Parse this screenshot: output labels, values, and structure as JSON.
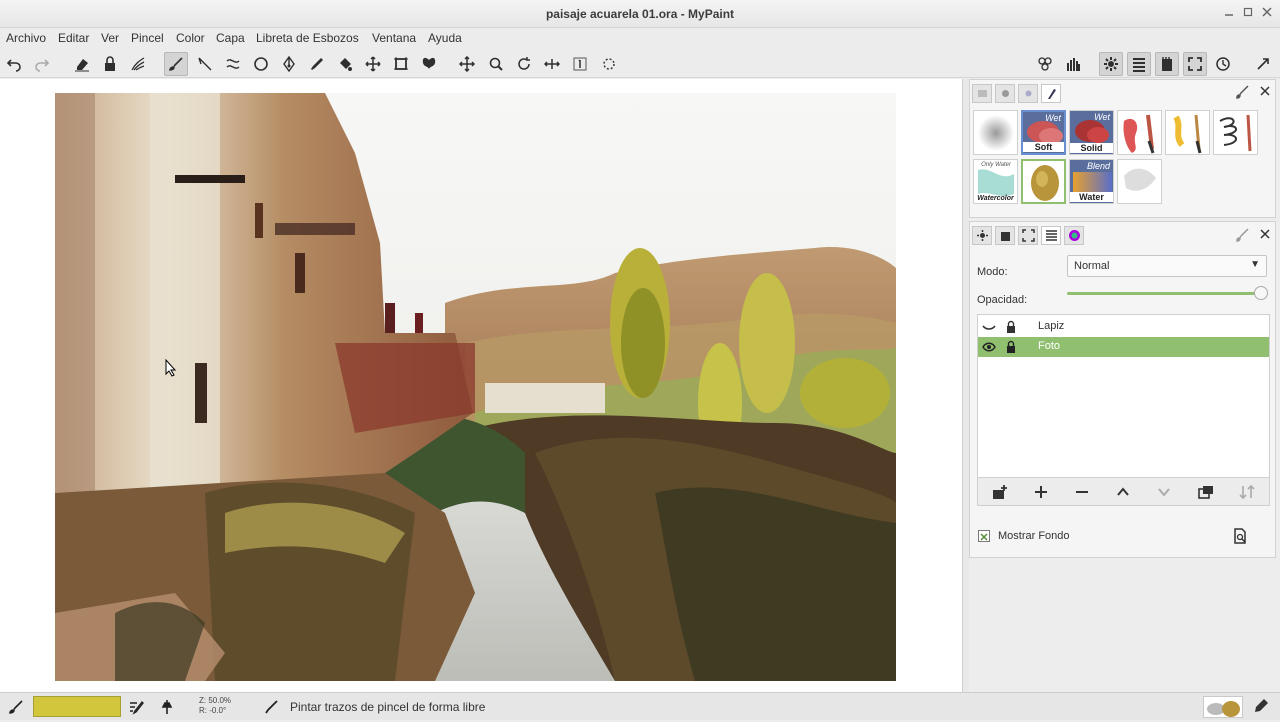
{
  "window": {
    "title": "paisaje acuarela 01.ora - MyPaint",
    "minimize_icon": "minimize-icon",
    "maximize_icon": "maximize-icon",
    "close_icon": "close-icon"
  },
  "menu": [
    "Archivo",
    "Editar",
    "Ver",
    "Pincel",
    "Color",
    "Capa",
    "Libreta de Esbozos",
    "Ventana",
    "Ayuda"
  ],
  "brushes": {
    "row1": [
      {
        "label": "",
        "wet": ""
      },
      {
        "label": "Soft",
        "wet": "Wet"
      },
      {
        "label": "Solid",
        "wet": "Wet"
      },
      {
        "label": "",
        "wet": ""
      },
      {
        "label": "",
        "wet": ""
      },
      {
        "label": "",
        "wet": ""
      }
    ],
    "row2": [
      {
        "label": "Watercolor",
        "wet": "Only Water"
      },
      {
        "label": "",
        "wet": ""
      },
      {
        "label": "Water",
        "wet": "Blend"
      },
      {
        "label": "",
        "wet": ""
      }
    ]
  },
  "layers_panel": {
    "mode_label": "Modo:",
    "mode_value": "Normal",
    "opacity_label": "Opacidad:",
    "opacity_value": 1.0,
    "layers": [
      {
        "name": "Lapiz",
        "visible": false,
        "locked": true,
        "selected": false
      },
      {
        "name": "Foto",
        "visible": true,
        "locked": true,
        "selected": true
      }
    ],
    "show_background_label": "Mostrar Fondo"
  },
  "statusbar": {
    "color": "#d1c63c",
    "zoom": "Z: 50.0%",
    "rotation": "R: -0.0°",
    "message": "Pintar trazos de pincel de forma libre"
  },
  "colors": {
    "accent_green": "#8fbf6f",
    "selection_blue": "#6a8fd0"
  }
}
